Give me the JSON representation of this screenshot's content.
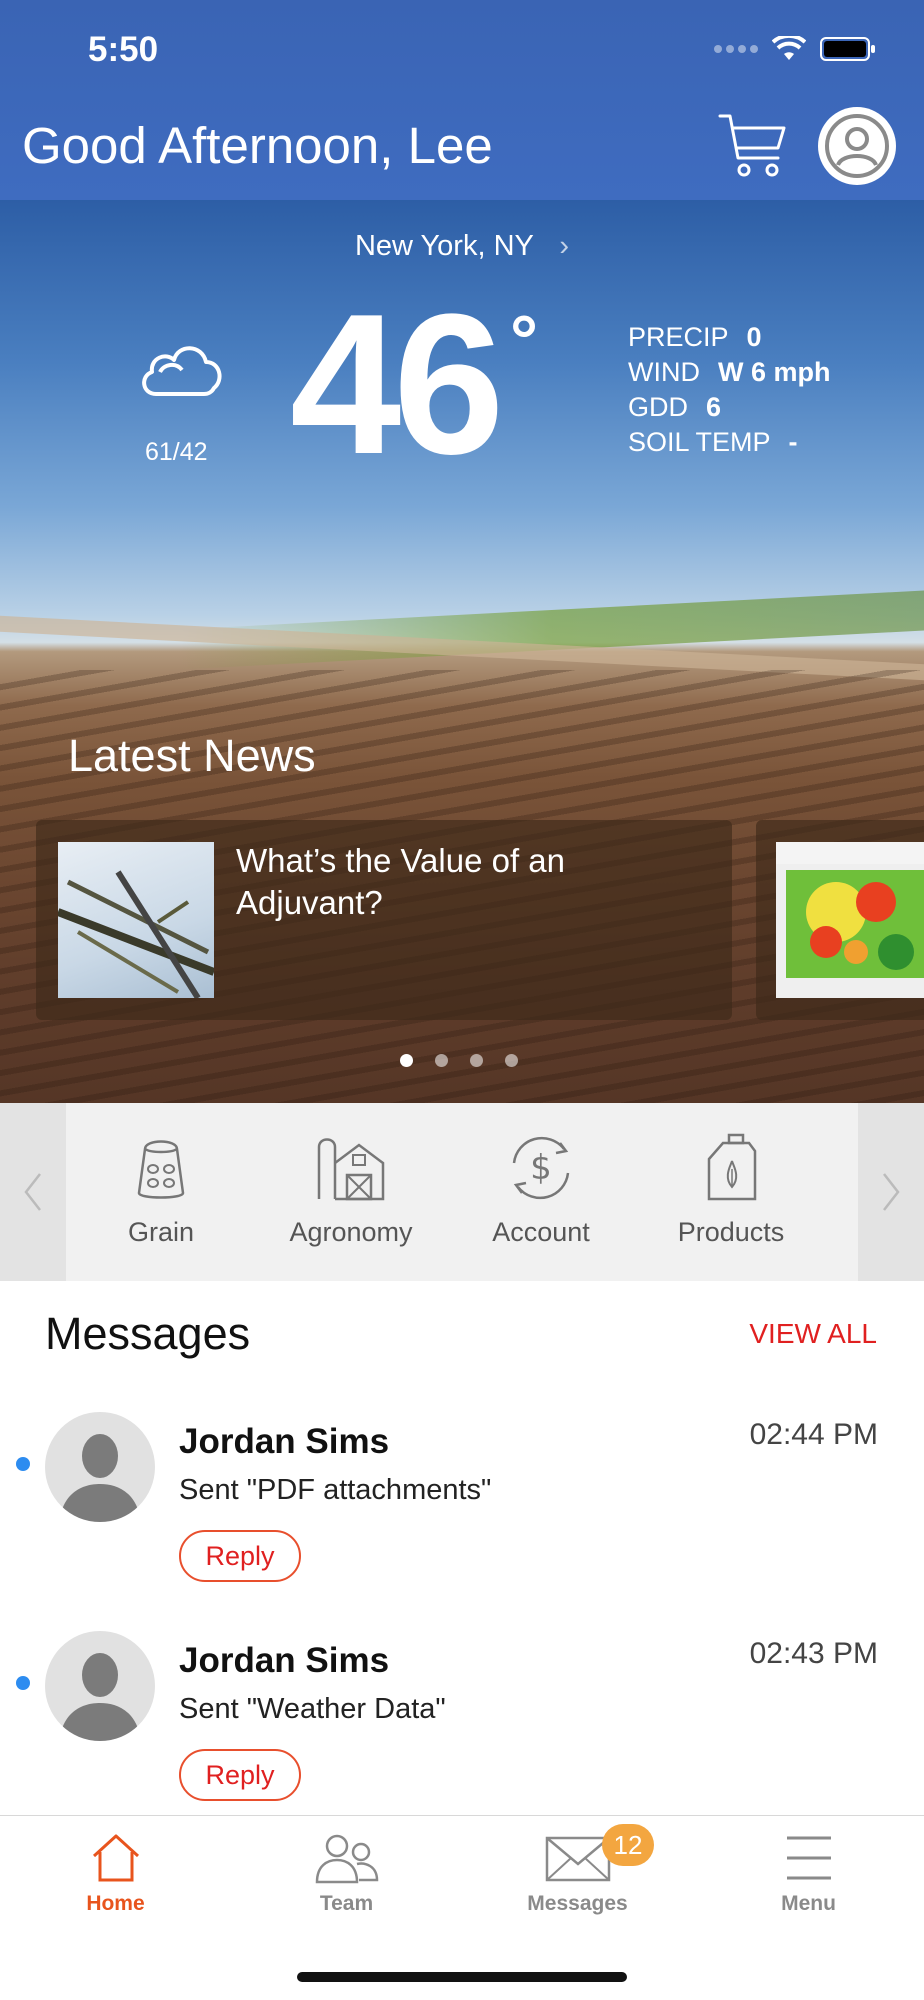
{
  "status_bar": {
    "time": "5:50"
  },
  "header": {
    "greeting": "Good Afternoon, Lee"
  },
  "weather": {
    "location": "New York, NY",
    "temperature": "46",
    "degree_symbol": "°",
    "hi_lo": "61/42",
    "condition_icon": "cloud-icon",
    "stats": [
      {
        "label": "PRECIP",
        "value": "0"
      },
      {
        "label": "WIND",
        "value": "W 6 mph"
      },
      {
        "label": "GDD",
        "value": "6"
      },
      {
        "label": "SOIL TEMP",
        "value": "-"
      }
    ]
  },
  "news": {
    "title": "Latest News",
    "items": [
      {
        "headline": "What’s the Value of an Adjuvant?"
      }
    ],
    "pager": {
      "count": 4,
      "active_index": 0
    }
  },
  "quicknav": {
    "items": [
      {
        "label": "Grain",
        "icon": "grain-bag-icon"
      },
      {
        "label": "Agronomy",
        "icon": "barn-icon"
      },
      {
        "label": "Account",
        "icon": "dollar-cycle-icon"
      },
      {
        "label": "Products",
        "icon": "jug-icon"
      }
    ]
  },
  "messages": {
    "title": "Messages",
    "view_all": "VIEW ALL",
    "items": [
      {
        "name": "Jordan Sims",
        "text": "Sent \"PDF attachments\"",
        "time": "02:44 PM",
        "reply": "Reply",
        "unread": true
      },
      {
        "name": "Jordan Sims",
        "text": "Sent \"Weather Data\"",
        "time": "02:43 PM",
        "reply": "Reply",
        "unread": true
      }
    ]
  },
  "tabbar": {
    "tabs": [
      {
        "label": "Home",
        "icon": "home-icon",
        "active": true
      },
      {
        "label": "Team",
        "icon": "team-icon",
        "active": false
      },
      {
        "label": "Messages",
        "icon": "envelope-icon",
        "active": false,
        "badge": "12"
      },
      {
        "label": "Menu",
        "icon": "menu-icon",
        "active": false
      }
    ]
  },
  "colors": {
    "header_blue": "#3f6cc0",
    "accent_orange": "#e8541d",
    "alert_red": "#e02020",
    "badge_orange": "#f3a640",
    "unread_blue": "#2d8cf0"
  }
}
